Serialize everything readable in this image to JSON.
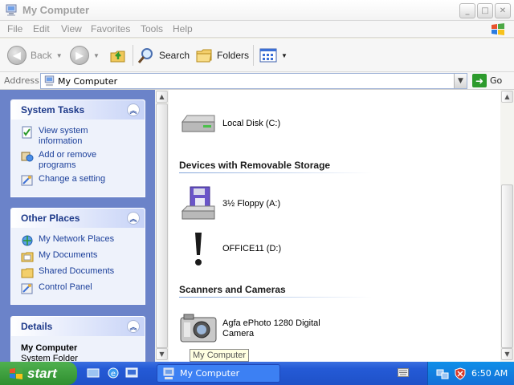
{
  "window": {
    "title": "My Computer",
    "buttons": {
      "minimize": "_",
      "maximize": "□",
      "close": "✕"
    }
  },
  "menu": [
    "File",
    "Edit",
    "View",
    "Favorites",
    "Tools",
    "Help"
  ],
  "toolbar": {
    "back_label": "Back",
    "search_label": "Search",
    "folders_label": "Folders"
  },
  "address": {
    "label": "Address",
    "value": "My Computer",
    "go_label": "Go"
  },
  "left_pane": {
    "system_tasks": {
      "title": "System Tasks",
      "items": [
        "View system information",
        "Add or remove programs",
        "Change a setting"
      ]
    },
    "other_places": {
      "title": "Other Places",
      "items": [
        "My Network Places",
        "My Documents",
        "Shared Documents",
        "Control Panel"
      ]
    },
    "details": {
      "title": "Details",
      "name": "My Computer",
      "type": "System Folder"
    }
  },
  "content": {
    "hard_disk": {
      "label": "Local Disk (C:)"
    },
    "removable": {
      "title": "Devices with Removable Storage",
      "items": [
        "3½ Floppy (A:)",
        "OFFICE11 (D:)"
      ]
    },
    "scanners": {
      "title": "Scanners and Cameras",
      "items": [
        "Agfa ePhoto 1280 Digital Camera"
      ]
    }
  },
  "tooltip": "My Computer",
  "taskbar": {
    "start_label": "start",
    "window_button": "My Computer",
    "clock": "6:50 AM"
  }
}
